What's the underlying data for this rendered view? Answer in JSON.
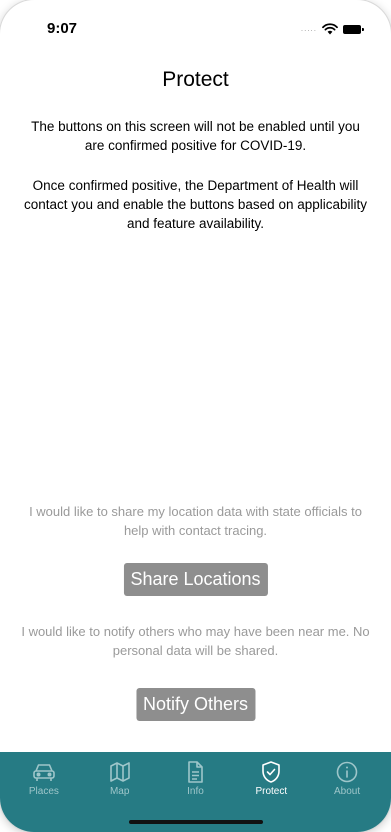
{
  "status_bar": {
    "time": "9:07",
    "signal_dots": "....."
  },
  "header": {
    "title": "Protect"
  },
  "intro": {
    "paragraph_1": "The buttons on this screen will not be enabled until you are confirmed positive for COVID-19.",
    "paragraph_2": "Once confirmed positive, the Department of Health will contact you and enable the buttons based on applicability and feature availability."
  },
  "share_section": {
    "prompt": "I would like to share my location data with state officials to help with contact tracing.",
    "button_label": "Share Locations"
  },
  "notify_section": {
    "prompt": "I would like to notify others who may have been near me.  No personal data will be shared.",
    "button_label": "Notify Others"
  },
  "tab_bar": {
    "background": "#267b84",
    "items": [
      {
        "label": "Places",
        "icon": "car-icon",
        "active": false
      },
      {
        "label": "Map",
        "icon": "map-icon",
        "active": false
      },
      {
        "label": "Info",
        "icon": "document-icon",
        "active": false
      },
      {
        "label": "Protect",
        "icon": "shield-check-icon",
        "active": true
      },
      {
        "label": "About",
        "icon": "info-circle-icon",
        "active": false
      }
    ]
  }
}
